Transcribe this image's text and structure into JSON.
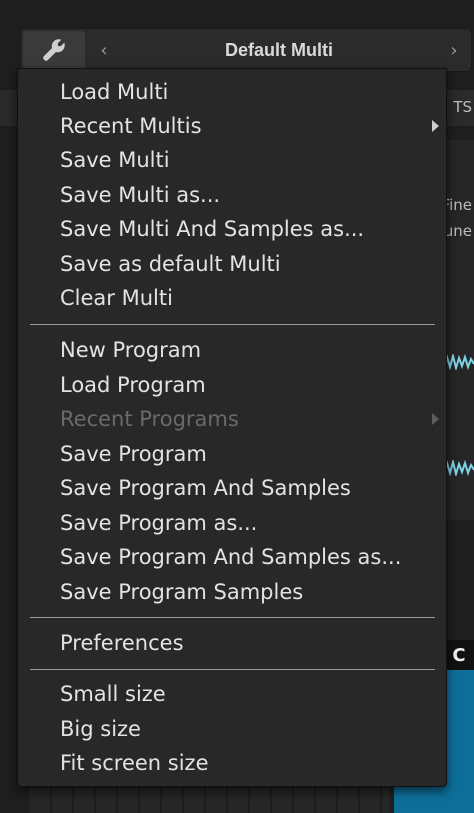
{
  "header": {
    "title": "Default Multi",
    "prev_arrow": "‹",
    "next_arrow": "›"
  },
  "background": {
    "right_text_1": "TS",
    "right_text_2": "Fine",
    "right_text_3": "une",
    "right_label": "C"
  },
  "menu": {
    "multi": [
      {
        "label": "Load Multi"
      },
      {
        "label": "Recent Multis"
      },
      {
        "label": "Save Multi"
      },
      {
        "label": "Save Multi as..."
      },
      {
        "label": "Save Multi And Samples as..."
      },
      {
        "label": "Save as default Multi"
      },
      {
        "label": "Clear Multi"
      }
    ],
    "program": [
      {
        "label": "New Program"
      },
      {
        "label": "Load Program"
      },
      {
        "label": "Recent Programs"
      },
      {
        "label": "Save Program"
      },
      {
        "label": "Save Program And Samples"
      },
      {
        "label": "Save Program as..."
      },
      {
        "label": "Save Program And Samples as..."
      },
      {
        "label": "Save Program Samples"
      }
    ],
    "prefs": [
      {
        "label": "Preferences"
      }
    ],
    "size": [
      {
        "label": "Small size"
      },
      {
        "label": "Big size"
      },
      {
        "label": "Fit screen size"
      }
    ]
  },
  "colors": {
    "menu_bg": "#282828",
    "text": "#e3e3e3",
    "disabled_text": "#6a6a6a",
    "accent_wave": "#7fd3e6"
  }
}
